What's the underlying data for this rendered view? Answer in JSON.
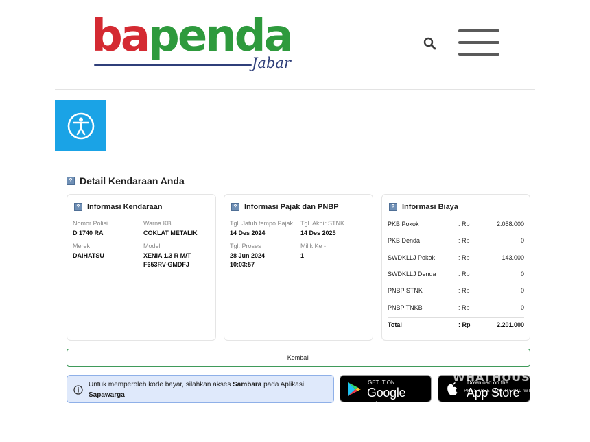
{
  "header": {
    "logo_text_red": "ba",
    "logo_text_green": "penda",
    "logo_sub": "Jabar",
    "search_icon": "search-icon",
    "menu_icon": "hamburger-menu-icon"
  },
  "accessibility": {
    "icon": "accessibility-icon",
    "color": "#1aa3e6"
  },
  "section": {
    "title": "Detail Kendaraan Anda"
  },
  "vehicle": {
    "title": "Informasi Kendaraan",
    "plate_label": "Nomor Polisi",
    "plate_value": "D 1740 RA",
    "color_label": "Warna KB",
    "color_value": "COKLAT METALIK",
    "brand_label": "Merek",
    "brand_value": "DAIHATSU",
    "model_label": "Model",
    "model_value": "XENIA 1.3 R M/T F653RV-GMDFJ"
  },
  "tax": {
    "title": "Informasi Pajak dan PNBP",
    "due_label": "Tgl. Jatuh tempo Pajak",
    "due_value": "14 Des 2024",
    "stnk_label": "Tgl. Akhir STNK",
    "stnk_value": "14 Des 2025",
    "process_label": "Tgl. Proses",
    "process_date": "28 Jun 2024",
    "process_time": "10:03:57",
    "owner_label": "Milik Ke -",
    "owner_value": "1"
  },
  "costs": {
    "title": "Informasi Biaya",
    "rows": [
      {
        "name": "PKB Pokok",
        "currency": ": Rp",
        "value": "2.058.000"
      },
      {
        "name": "PKB Denda",
        "currency": ": Rp",
        "value": "0"
      },
      {
        "name": "SWDKLLJ Pokok",
        "currency": ": Rp",
        "value": "143.000"
      },
      {
        "name": "SWDKLLJ Denda",
        "currency": ": Rp",
        "value": "0"
      },
      {
        "name": "PNBP STNK",
        "currency": ": Rp",
        "value": "0"
      },
      {
        "name": "PNBP TNKB",
        "currency": ": Rp",
        "value": "0"
      }
    ],
    "total": {
      "name": "Total",
      "currency": ": Rp",
      "value": "2.201.000"
    }
  },
  "back_button": {
    "label": "Kembali",
    "accent": "#3f9a5a"
  },
  "notice": {
    "icon": "info-icon",
    "text_before": "Untuk memperoleh kode bayar, silahkan akses ",
    "app_name": "Sambara",
    "text_middle": " pada Aplikasi ",
    "platform": "Sapawarga"
  },
  "store_badges": {
    "google_small": "GET IT ON",
    "google_big": "Google Play",
    "apple_small": "Download on the",
    "apple_big": "App Store"
  },
  "watermark": {
    "text": "WHATHOUSE",
    "subtext": "PRESTIGE FOR MOBIL WEB"
  }
}
